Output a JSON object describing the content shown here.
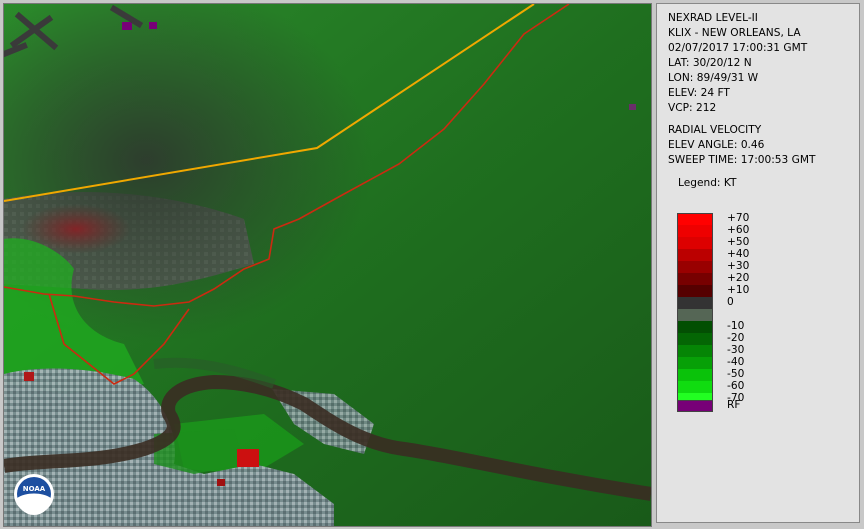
{
  "info": {
    "lines": [
      "NEXRAD LEVEL-II",
      "KLIX - NEW ORLEANS, LA",
      "02/07/2017 17:00:31 GMT",
      "LAT: 30/20/12 N",
      "LON: 89/49/31 W",
      "ELEV: 24 FT",
      "VCP: 212"
    ],
    "product_lines": [
      "RADIAL VELOCITY",
      "ELEV ANGLE: 0.46",
      "SWEEP TIME: 17:00:53 GMT"
    ]
  },
  "legend": {
    "title": "Legend: KT",
    "entries": [
      {
        "label": "+70",
        "color": "#ff0000"
      },
      {
        "label": "+60",
        "color": "#ee0000"
      },
      {
        "label": "+50",
        "color": "#dd0000"
      },
      {
        "label": "+40",
        "color": "#bb0000"
      },
      {
        "label": "+30",
        "color": "#990000"
      },
      {
        "label": "+20",
        "color": "#770000"
      },
      {
        "label": "+10",
        "color": "#550000"
      },
      {
        "label": "0",
        "color": "#333333"
      },
      {
        "label": "",
        "color": "#556655"
      },
      {
        "label": "-10",
        "color": "#034f03"
      },
      {
        "label": "-20",
        "color": "#046604"
      },
      {
        "label": "-30",
        "color": "#058505"
      },
      {
        "label": "-40",
        "color": "#07a007"
      },
      {
        "label": "-50",
        "color": "#0ac20a"
      },
      {
        "label": "-60",
        "color": "#10dc10"
      },
      {
        "label": "-70",
        "color": "#22ff22"
      }
    ],
    "rf": {
      "label": "RF",
      "color": "#770077"
    }
  },
  "map": {
    "logo_text": "NOAA",
    "colors": {
      "border": "#f0a800",
      "road": "#cc2a10",
      "river": "#3a2c22"
    }
  }
}
